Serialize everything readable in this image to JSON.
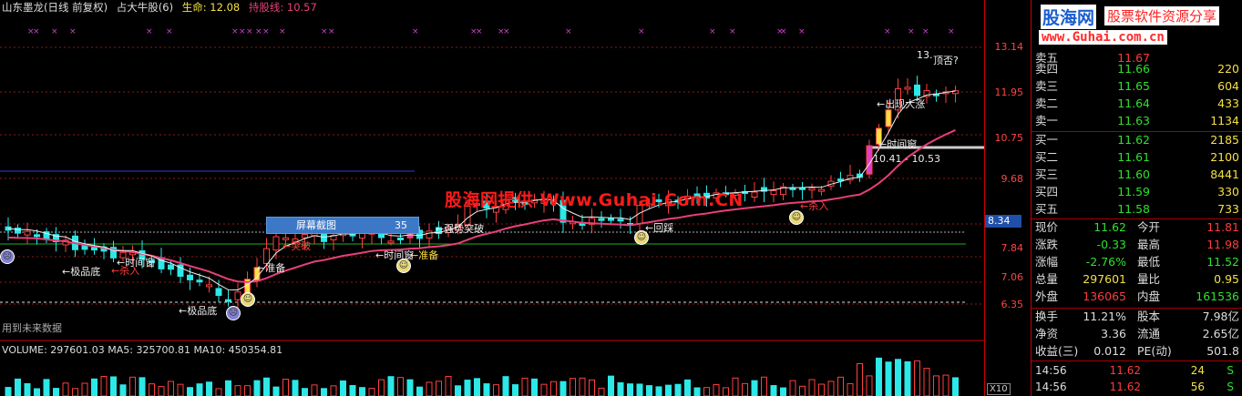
{
  "header": {
    "stock_name": "山东墨龙(日线 前复权)",
    "indicator_name": "占大牛股(6)",
    "life_label": "生命: 12.08",
    "hold_label": "持股线: 10.57"
  },
  "watermark": "股海网提供 Www.Guhai.Com.CN",
  "screenshot_bar": {
    "label": "屏幕截图",
    "value": "35"
  },
  "future_note": "用到未来数据",
  "volume_header": "VOLUME: 297601.03  MA5: 325700.81  MA10: 450354.81",
  "price_axis": {
    "labels": [
      "13.14",
      "11.95",
      "10.75",
      "9.68",
      "7.84",
      "7.06",
      "6.35"
    ],
    "highlight": "8.34"
  },
  "x10_label": "X10",
  "annotations": {
    "bottom1": "极品底",
    "bottom2": "极品底",
    "time_window_1": "时间窗",
    "time_window_2": "时间窗",
    "time_window_3": "时间窗",
    "prepare_1": "准备",
    "prepare_2": "准备",
    "buy_1": "杀入",
    "buy_2": "杀入",
    "breakout": "强势突破",
    "big_rise": "出现大涨",
    "top": "顶否?",
    "peak_label": "13.",
    "range_label": "10.41 - 10.53",
    "breakthrough_2": "突破",
    "pullback": "回踩"
  },
  "logo": {
    "brand": "股海网",
    "slogan": "股票软件资源分享",
    "url": "www.Guhai.com.cn"
  },
  "quote": {
    "partial_row": {
      "label": "卖五",
      "price": "11.67",
      "qty": ""
    },
    "sell": [
      {
        "label": "卖四",
        "price": "11.66",
        "qty": "220"
      },
      {
        "label": "卖三",
        "price": "11.65",
        "qty": "604"
      },
      {
        "label": "卖二",
        "price": "11.64",
        "qty": "433"
      },
      {
        "label": "卖一",
        "price": "11.63",
        "qty": "1134"
      }
    ],
    "buy": [
      {
        "label": "买一",
        "price": "11.62",
        "qty": "2185"
      },
      {
        "label": "买二",
        "price": "11.61",
        "qty": "2100"
      },
      {
        "label": "买三",
        "price": "11.60",
        "qty": "8441"
      },
      {
        "label": "买四",
        "price": "11.59",
        "qty": "330"
      },
      {
        "label": "买五",
        "price": "11.58",
        "qty": "733"
      }
    ],
    "stats": [
      {
        "l1": "现价",
        "v1": "11.62",
        "l2": "今开",
        "v2": "11.81"
      },
      {
        "l1": "涨跌",
        "v1": "-0.33",
        "l2": "最高",
        "v2": "11.98"
      },
      {
        "l1": "涨幅",
        "v1": "-2.76%",
        "l2": "最低",
        "v2": "11.52"
      },
      {
        "l1": "总量",
        "v1": "297601",
        "l2": "量比",
        "v2": "0.95"
      },
      {
        "l1": "外盘",
        "v1": "136065",
        "l2": "内盘",
        "v2": "161536"
      }
    ],
    "stats2": [
      {
        "l1": "换手",
        "v1": "11.21%",
        "l2": "股本",
        "v2": "7.98亿"
      },
      {
        "l1": "净资",
        "v1": "3.36",
        "l2": "流通",
        "v2": "2.65亿"
      },
      {
        "l1": "收益(三)",
        "v1": "0.012",
        "l2": "PE(动)",
        "v2": "501.8"
      }
    ],
    "ticks": [
      {
        "time": "14:56",
        "price": "11.62",
        "vol": "24",
        "side": "S"
      },
      {
        "time": "14:56",
        "price": "11.62",
        "vol": "56",
        "side": "S"
      }
    ]
  },
  "colors": {
    "up": "#ff3b3b",
    "down": "#2fe02f",
    "accent": "#f5e042",
    "ma": "#e8407a"
  }
}
